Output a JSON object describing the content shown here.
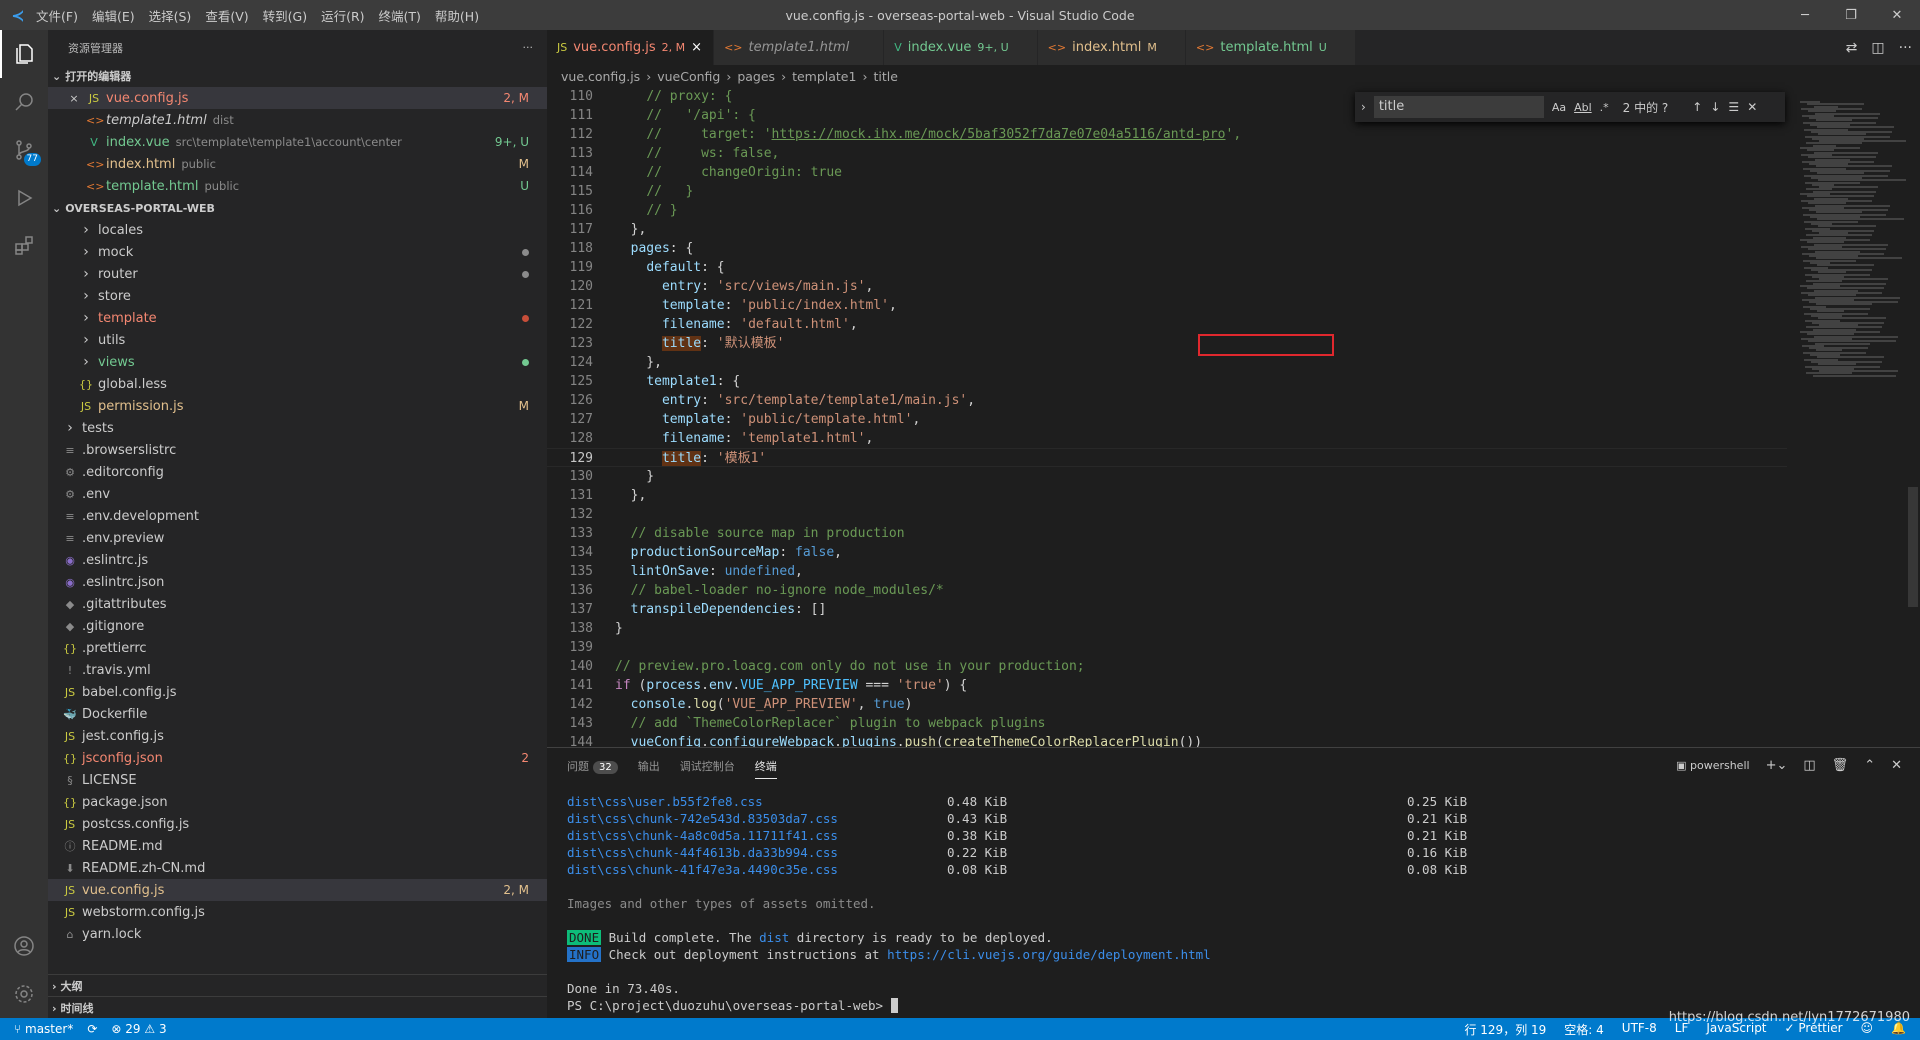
{
  "titlebar": {
    "menu": [
      "文件(F)",
      "编辑(E)",
      "选择(S)",
      "查看(V)",
      "转到(G)",
      "运行(R)",
      "终端(T)",
      "帮助(H)"
    ],
    "title": "vue.config.js - overseas-portal-web - Visual Studio Code"
  },
  "activity": {
    "scm_badge": "77"
  },
  "sidebar": {
    "header": "资源管理器",
    "open_editors_label": "打开的编辑器",
    "open_editors": [
      {
        "name": "vue.config.js",
        "desc": "",
        "status": "2, M",
        "icon": "JS",
        "close": "×"
      },
      {
        "name": "template1.html",
        "desc": "dist",
        "status": "",
        "icon": "<>"
      },
      {
        "name": "index.vue",
        "desc": "src\\template\\template1\\account\\center",
        "status": "9+, U",
        "icon": "V"
      },
      {
        "name": "index.html",
        "desc": "public",
        "status": "M",
        "icon": "<>"
      },
      {
        "name": "template.html",
        "desc": "public",
        "status": "U",
        "icon": "<>"
      }
    ],
    "project_label": "OVERSEAS-PORTAL-WEB",
    "tree": [
      {
        "name": "locales",
        "type": "folder",
        "indent": 1
      },
      {
        "name": "mock",
        "type": "folder",
        "indent": 1,
        "dot": "#8b8b8b"
      },
      {
        "name": "router",
        "type": "folder",
        "indent": 1,
        "dot": "#8b8b8b"
      },
      {
        "name": "store",
        "type": "folder",
        "indent": 1
      },
      {
        "name": "template",
        "type": "folder",
        "indent": 1,
        "dot": "#c74e39",
        "color": "red"
      },
      {
        "name": "utils",
        "type": "folder",
        "indent": 1
      },
      {
        "name": "views",
        "type": "folder",
        "indent": 1,
        "dot": "#73c991",
        "color": "grn"
      },
      {
        "name": "global.less",
        "type": "file",
        "icon": "{}",
        "indent": 1
      },
      {
        "name": "permission.js",
        "type": "file",
        "icon": "JS",
        "indent": 1,
        "status": "M",
        "color": "mod"
      },
      {
        "name": "tests",
        "type": "folder",
        "indent": 0
      },
      {
        "name": ".browserslistrc",
        "type": "file",
        "icon": "≡",
        "indent": 0
      },
      {
        "name": ".editorconfig",
        "type": "file",
        "icon": "⚙",
        "indent": 0
      },
      {
        "name": ".env",
        "type": "file",
        "icon": "⚙",
        "indent": 0
      },
      {
        "name": ".env.development",
        "type": "file",
        "icon": "≡",
        "indent": 0
      },
      {
        "name": ".env.preview",
        "type": "file",
        "icon": "≡",
        "indent": 0
      },
      {
        "name": ".eslintrc.js",
        "type": "file",
        "icon": "◉",
        "indent": 0
      },
      {
        "name": ".eslintrc.json",
        "type": "file",
        "icon": "◉",
        "indent": 0
      },
      {
        "name": ".gitattributes",
        "type": "file",
        "icon": "◆",
        "indent": 0
      },
      {
        "name": ".gitignore",
        "type": "file",
        "icon": "◆",
        "indent": 0
      },
      {
        "name": ".prettierrc",
        "type": "file",
        "icon": "{}",
        "indent": 0
      },
      {
        "name": ".travis.yml",
        "type": "file",
        "icon": "!",
        "indent": 0
      },
      {
        "name": "babel.config.js",
        "type": "file",
        "icon": "JS",
        "indent": 0
      },
      {
        "name": "Dockerfile",
        "type": "file",
        "icon": "🐳",
        "indent": 0
      },
      {
        "name": "jest.config.js",
        "type": "file",
        "icon": "JS",
        "indent": 0
      },
      {
        "name": "jsconfig.json",
        "type": "file",
        "icon": "{}",
        "indent": 0,
        "status": "2",
        "color": "red"
      },
      {
        "name": "LICENSE",
        "type": "file",
        "icon": "§",
        "indent": 0
      },
      {
        "name": "package.json",
        "type": "file",
        "icon": "{}",
        "indent": 0
      },
      {
        "name": "postcss.config.js",
        "type": "file",
        "icon": "JS",
        "indent": 0
      },
      {
        "name": "README.md",
        "type": "file",
        "icon": "ⓘ",
        "indent": 0
      },
      {
        "name": "README.zh-CN.md",
        "type": "file",
        "icon": "⬇",
        "indent": 0
      },
      {
        "name": "vue.config.js",
        "type": "file",
        "icon": "JS",
        "indent": 0,
        "status": "2, M",
        "color": "mod",
        "selected": true
      },
      {
        "name": "webstorm.config.js",
        "type": "file",
        "icon": "JS",
        "indent": 0
      },
      {
        "name": "yarn.lock",
        "type": "file",
        "icon": "⌂",
        "indent": 0
      }
    ],
    "outline_label": "大纲",
    "timeline_label": "时间线"
  },
  "tabs": [
    {
      "label": "vue.config.js",
      "status": "2, M",
      "icon": "JS",
      "active": true,
      "close": "×"
    },
    {
      "label": "template1.html",
      "status": "",
      "icon": "<>"
    },
    {
      "label": "index.vue",
      "status": "9+, U",
      "icon": "V"
    },
    {
      "label": "index.html",
      "status": "M",
      "icon": "<>"
    },
    {
      "label": "template.html",
      "status": "U",
      "icon": "<>"
    }
  ],
  "breadcrumb": [
    "vue.config.js",
    "vueConfig",
    "pages",
    "template1",
    "title"
  ],
  "find": {
    "value": "title",
    "count": "2 中的 ?",
    "opt_case": "Aa",
    "opt_word": "Abl",
    "opt_regex": ".*"
  },
  "code": [
    {
      "n": "110",
      "h": "    <span class='cm'>// proxy: {</span>"
    },
    {
      "n": "111",
      "h": "    <span class='cm'>//   '/api': {</span>"
    },
    {
      "n": "112",
      "h": "    <span class='cm'>//     target: '</span><span class='cm' style='text-decoration:underline'>https://mock.ihx.me/mock/5baf3052f7da7e07e04a5116/antd-pro</span><span class='cm'>',</span>"
    },
    {
      "n": "113",
      "h": "    <span class='cm'>//     ws: false,</span>"
    },
    {
      "n": "114",
      "h": "    <span class='cm'>//     changeOrigin: true</span>"
    },
    {
      "n": "115",
      "h": "    <span class='cm'>//   }</span>"
    },
    {
      "n": "116",
      "h": "    <span class='cm'>// }</span>"
    },
    {
      "n": "117",
      "h": "  },"
    },
    {
      "n": "118",
      "h": "  <span class='pr'>pages</span>: {"
    },
    {
      "n": "119",
      "h": "    <span class='pr'>default</span>: {"
    },
    {
      "n": "120",
      "h": "      <span class='pr'>entry</span>: <span class='st'>'src/views/main.js'</span>,"
    },
    {
      "n": "121",
      "h": "      <span class='pr'>template</span>: <span class='st'>'public/index.html'</span>,"
    },
    {
      "n": "122",
      "h": "      <span class='pr'>filename</span>: <span class='st'>'default.html'</span>,"
    },
    {
      "n": "123",
      "h": "      <span class='pr' style='background:#613214'>title</span>: <span class='st'>'默认模板'</span>"
    },
    {
      "n": "124",
      "h": "    },"
    },
    {
      "n": "125",
      "h": "    <span class='pr'>template1</span>: {"
    },
    {
      "n": "126",
      "h": "      <span class='pr'>entry</span>: <span class='st'>'src/template/template1/main.js'</span>,"
    },
    {
      "n": "127",
      "h": "      <span class='pr'>template</span>: <span class='st'>'public/template.html'</span>,"
    },
    {
      "n": "128",
      "h": "      <span class='pr'>filename</span>: <span class='st'>'template1.html'</span>,"
    },
    {
      "n": "129",
      "h": "      <span class='pr' style='background:#613214'>title</span>: <span class='st'>'模板1'</span>",
      "cur": true
    },
    {
      "n": "130",
      "h": "    }"
    },
    {
      "n": "131",
      "h": "  },"
    },
    {
      "n": "132",
      "h": ""
    },
    {
      "n": "133",
      "h": "  <span class='cm'>// disable source map in production</span>"
    },
    {
      "n": "134",
      "h": "  <span class='pr'>productionSourceMap</span>: <span class='kw'>false</span>,"
    },
    {
      "n": "135",
      "h": "  <span class='pr'>lintOnSave</span>: <span class='kw'>undefined</span>,"
    },
    {
      "n": "136",
      "h": "  <span class='cm'>// babel-loader no-ignore node_modules/*</span>"
    },
    {
      "n": "137",
      "h": "  <span class='pr'>transpileDependencies</span>: []"
    },
    {
      "n": "138",
      "h": "}"
    },
    {
      "n": "139",
      "h": ""
    },
    {
      "n": "140",
      "h": "<span class='cm'>// preview.pro.loacg.com only do not use in your production;</span>"
    },
    {
      "n": "141",
      "h": "<span class='kw' style='color:#c586c0'>if</span> (<span class='pr'>process</span>.<span class='pr'>env</span>.<span class='vr'>VUE_APP_PREVIEW</span> === <span class='st'>'true'</span>) {"
    },
    {
      "n": "142",
      "h": "  <span class='pr'>console</span>.<span class='fn'>log</span>(<span class='st'>'VUE_APP_PREVIEW'</span>, <span class='kw'>true</span>)"
    },
    {
      "n": "143",
      "h": "  <span class='cm'>// add `ThemeColorReplacer` plugin to webpack plugins</span>"
    },
    {
      "n": "144",
      "h": "  <span class='pr'>vueConfig</span>.<span class='pr'>configureWebpack</span>.<span class='pr'>plugins</span>.<span class='fn'>push</span>(<span class='fn'>createThemeColorReplacerPlugin</span>())"
    }
  ],
  "panel": {
    "tabs": [
      "问题",
      "输出",
      "调试控制台",
      "终端"
    ],
    "problems_count": "32",
    "shell": "powershell",
    "assets": [
      {
        "file": "dist\\css\\user.b55f2fe8.css",
        "size": "0.48 KiB",
        "gz": "0.25 KiB"
      },
      {
        "file": "dist\\css\\chunk-742e543d.83503da7.css",
        "size": "0.43 KiB",
        "gz": "0.21 KiB"
      },
      {
        "file": "dist\\css\\chunk-4a8c0d5a.11711f41.css",
        "size": "0.38 KiB",
        "gz": "0.21 KiB"
      },
      {
        "file": "dist\\css\\chunk-44f4613b.da33b994.css",
        "size": "0.22 KiB",
        "gz": "0.16 KiB"
      },
      {
        "file": "dist\\css\\chunk-41f47e3a.4490c35e.css",
        "size": "0.08 KiB",
        "gz": "0.08 KiB"
      }
    ],
    "omitted": "Images and other types of assets omitted.",
    "done_tag": "DONE",
    "done_pre": " Build complete. The ",
    "done_dist": "dist",
    "done_post": " directory is ready to be deployed.",
    "info_tag": "INFO",
    "info_pre": " Check out deployment instructions at ",
    "info_link": "https://cli.vuejs.org/guide/deployment.html",
    "done_time": "Done in 73.40s.",
    "prompt": "PS C:\\project\\duozuhu\\overseas-portal-web> "
  },
  "status": {
    "branch": "master*",
    "errors": "29",
    "warnings": "3",
    "position": "行 129，列 19",
    "spaces": "空格: 4",
    "encoding": "UTF-8",
    "eol": "LF",
    "lang": "JavaScript",
    "prettier": "Prettier",
    "watermark": "https://blog.csdn.net/lyn1772671980"
  }
}
